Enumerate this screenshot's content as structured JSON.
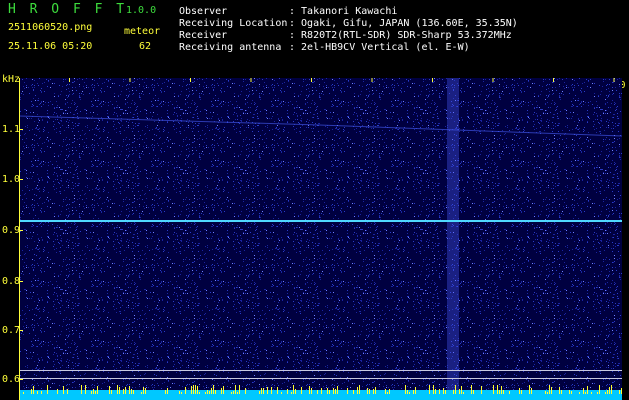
{
  "header": {
    "app_name": "H R O F F T",
    "version": "1.0.0",
    "filename": "2511060520.png",
    "mode": "meteor",
    "datetime": "25.11.06 05:20",
    "count": "62",
    "info": [
      {
        "label": "Observer",
        "value": ": Takanori Kawachi"
      },
      {
        "label": "Receiving Location",
        "value": ": Ogaki, Gifu, JAPAN (136.60E, 35.35N)"
      },
      {
        "label": "Receiver",
        "value": ": R820T2(RTL-SDR) SDR-Sharp 53.372MHz"
      },
      {
        "label": "Receiving antenna",
        "value": ": 2el-HB9CV Vertical (el. E-W)"
      }
    ]
  },
  "spectrogram": {
    "y_unit": "kHz",
    "time_ticks": [
      "0521",
      "0522",
      "0523",
      "0524",
      "0525",
      "0526",
      "0527",
      "0528",
      "0529",
      "0530"
    ],
    "freq_ticks": [
      "1.1",
      "1.0",
      "0.9",
      "0.8",
      "0.7",
      "0.6"
    ],
    "colors": {
      "background": "#000040",
      "noise": "#2a3cc8",
      "carrier": "#4fd8ff",
      "bottom_band": "#00c8ff",
      "bottom_spikes": "#ffff30",
      "axis": "#ffff3a"
    }
  }
}
